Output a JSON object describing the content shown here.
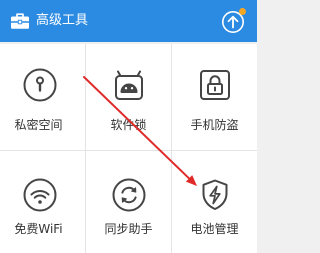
{
  "header": {
    "title": "高级工具",
    "left_icon": "toolbox-icon",
    "right_icon": "upgrade-icon",
    "background_color": "#2b8ae2",
    "badge_color": "#f5a623"
  },
  "tools": [
    {
      "label": "私密空间",
      "icon": "privacy-space-icon"
    },
    {
      "label": "软件锁",
      "icon": "app-lock-icon"
    },
    {
      "label": "手机防盗",
      "icon": "anti-theft-icon"
    },
    {
      "label": "免费WiFi",
      "icon": "wifi-icon"
    },
    {
      "label": "同步助手",
      "icon": "sync-icon"
    },
    {
      "label": "电池管理",
      "icon": "battery-shield-icon"
    }
  ],
  "colors": {
    "icon_stroke": "#454545",
    "label_text": "#333333",
    "divider": "#e4e4e4",
    "annotation_arrow": "#e02a2a"
  }
}
